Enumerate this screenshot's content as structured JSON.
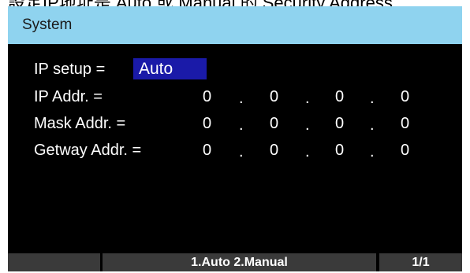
{
  "header_caption": "設定IP地址是 Auto 或 Manual 的 Security Address",
  "window": {
    "title": "System"
  },
  "ip_setup": {
    "label": "IP setup =",
    "value": "Auto"
  },
  "rows": [
    {
      "label": "IP Addr. =",
      "octets": [
        "0",
        "0",
        "0",
        "0"
      ]
    },
    {
      "label": "Mask Addr. =",
      "octets": [
        "0",
        "0",
        "0",
        "0"
      ]
    },
    {
      "label": "Getway Addr. =",
      "octets": [
        "0",
        "0",
        "0",
        "0"
      ]
    }
  ],
  "separator": ".",
  "footer": {
    "left": "",
    "center": "1.Auto 2.Manual",
    "right": "1/1"
  },
  "colors": {
    "title_bar": "#8fd3ef",
    "screen_bg": "#000000",
    "selection": "#1a1aa8",
    "softkey_bg": "#3a3a3a"
  }
}
